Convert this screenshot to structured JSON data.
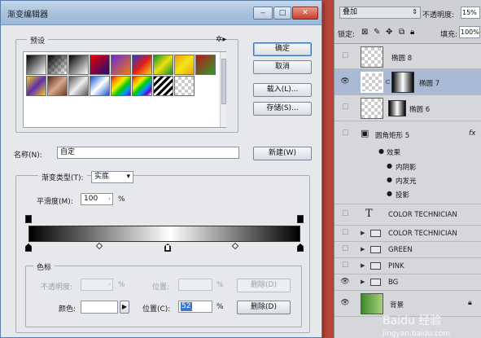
{
  "dialog": {
    "title": "渐变编辑器",
    "presets_label": "预设",
    "buttons": {
      "ok": "确定",
      "cancel": "取消",
      "load": "载入(L)...",
      "save": "存储(S)...",
      "new": "新建(W)"
    },
    "name_label": "名称(N):",
    "name_value": "自定",
    "gradient_type_label": "渐变类型(T):",
    "gradient_type_value": "实底",
    "smoothness_label": "平滑度(M):",
    "smoothness_value": "100",
    "smoothness_unit": "%",
    "stops_label": "色标",
    "opacity_label": "不透明度:",
    "opacity_unit": "%",
    "location_label": "位置:",
    "location_unit": "%",
    "delete_label": "删除(D)",
    "color_label": "颜色:",
    "location_c_label": "位置(C):",
    "location_c_value": "52",
    "location_c_unit": "%",
    "delete_label2": "删除(D)"
  },
  "layers_panel": {
    "blend_mode": "叠加",
    "opacity_label": "不透明度:",
    "opacity_value": "15%",
    "lock_label": "锁定:",
    "fill_label": "填充:",
    "fill_value": "100%",
    "layers": [
      {
        "name": "椭圆 8"
      },
      {
        "name": "椭圆 7"
      },
      {
        "name": "椭圆 6"
      },
      {
        "name": "圆角矩形 5"
      },
      {
        "name": "效果"
      },
      {
        "name": "内阴影"
      },
      {
        "name": "内发光"
      },
      {
        "name": "投影"
      },
      {
        "name": "COLOR TECHNICIAN"
      },
      {
        "name": "COLOR TECHNICIAN"
      },
      {
        "name": "GREEN"
      },
      {
        "name": "PINK"
      },
      {
        "name": "BG"
      },
      {
        "name": "背景"
      }
    ]
  },
  "watermark": "Baidu 经验",
  "watermark_sub": "jingyan.baidu.com"
}
